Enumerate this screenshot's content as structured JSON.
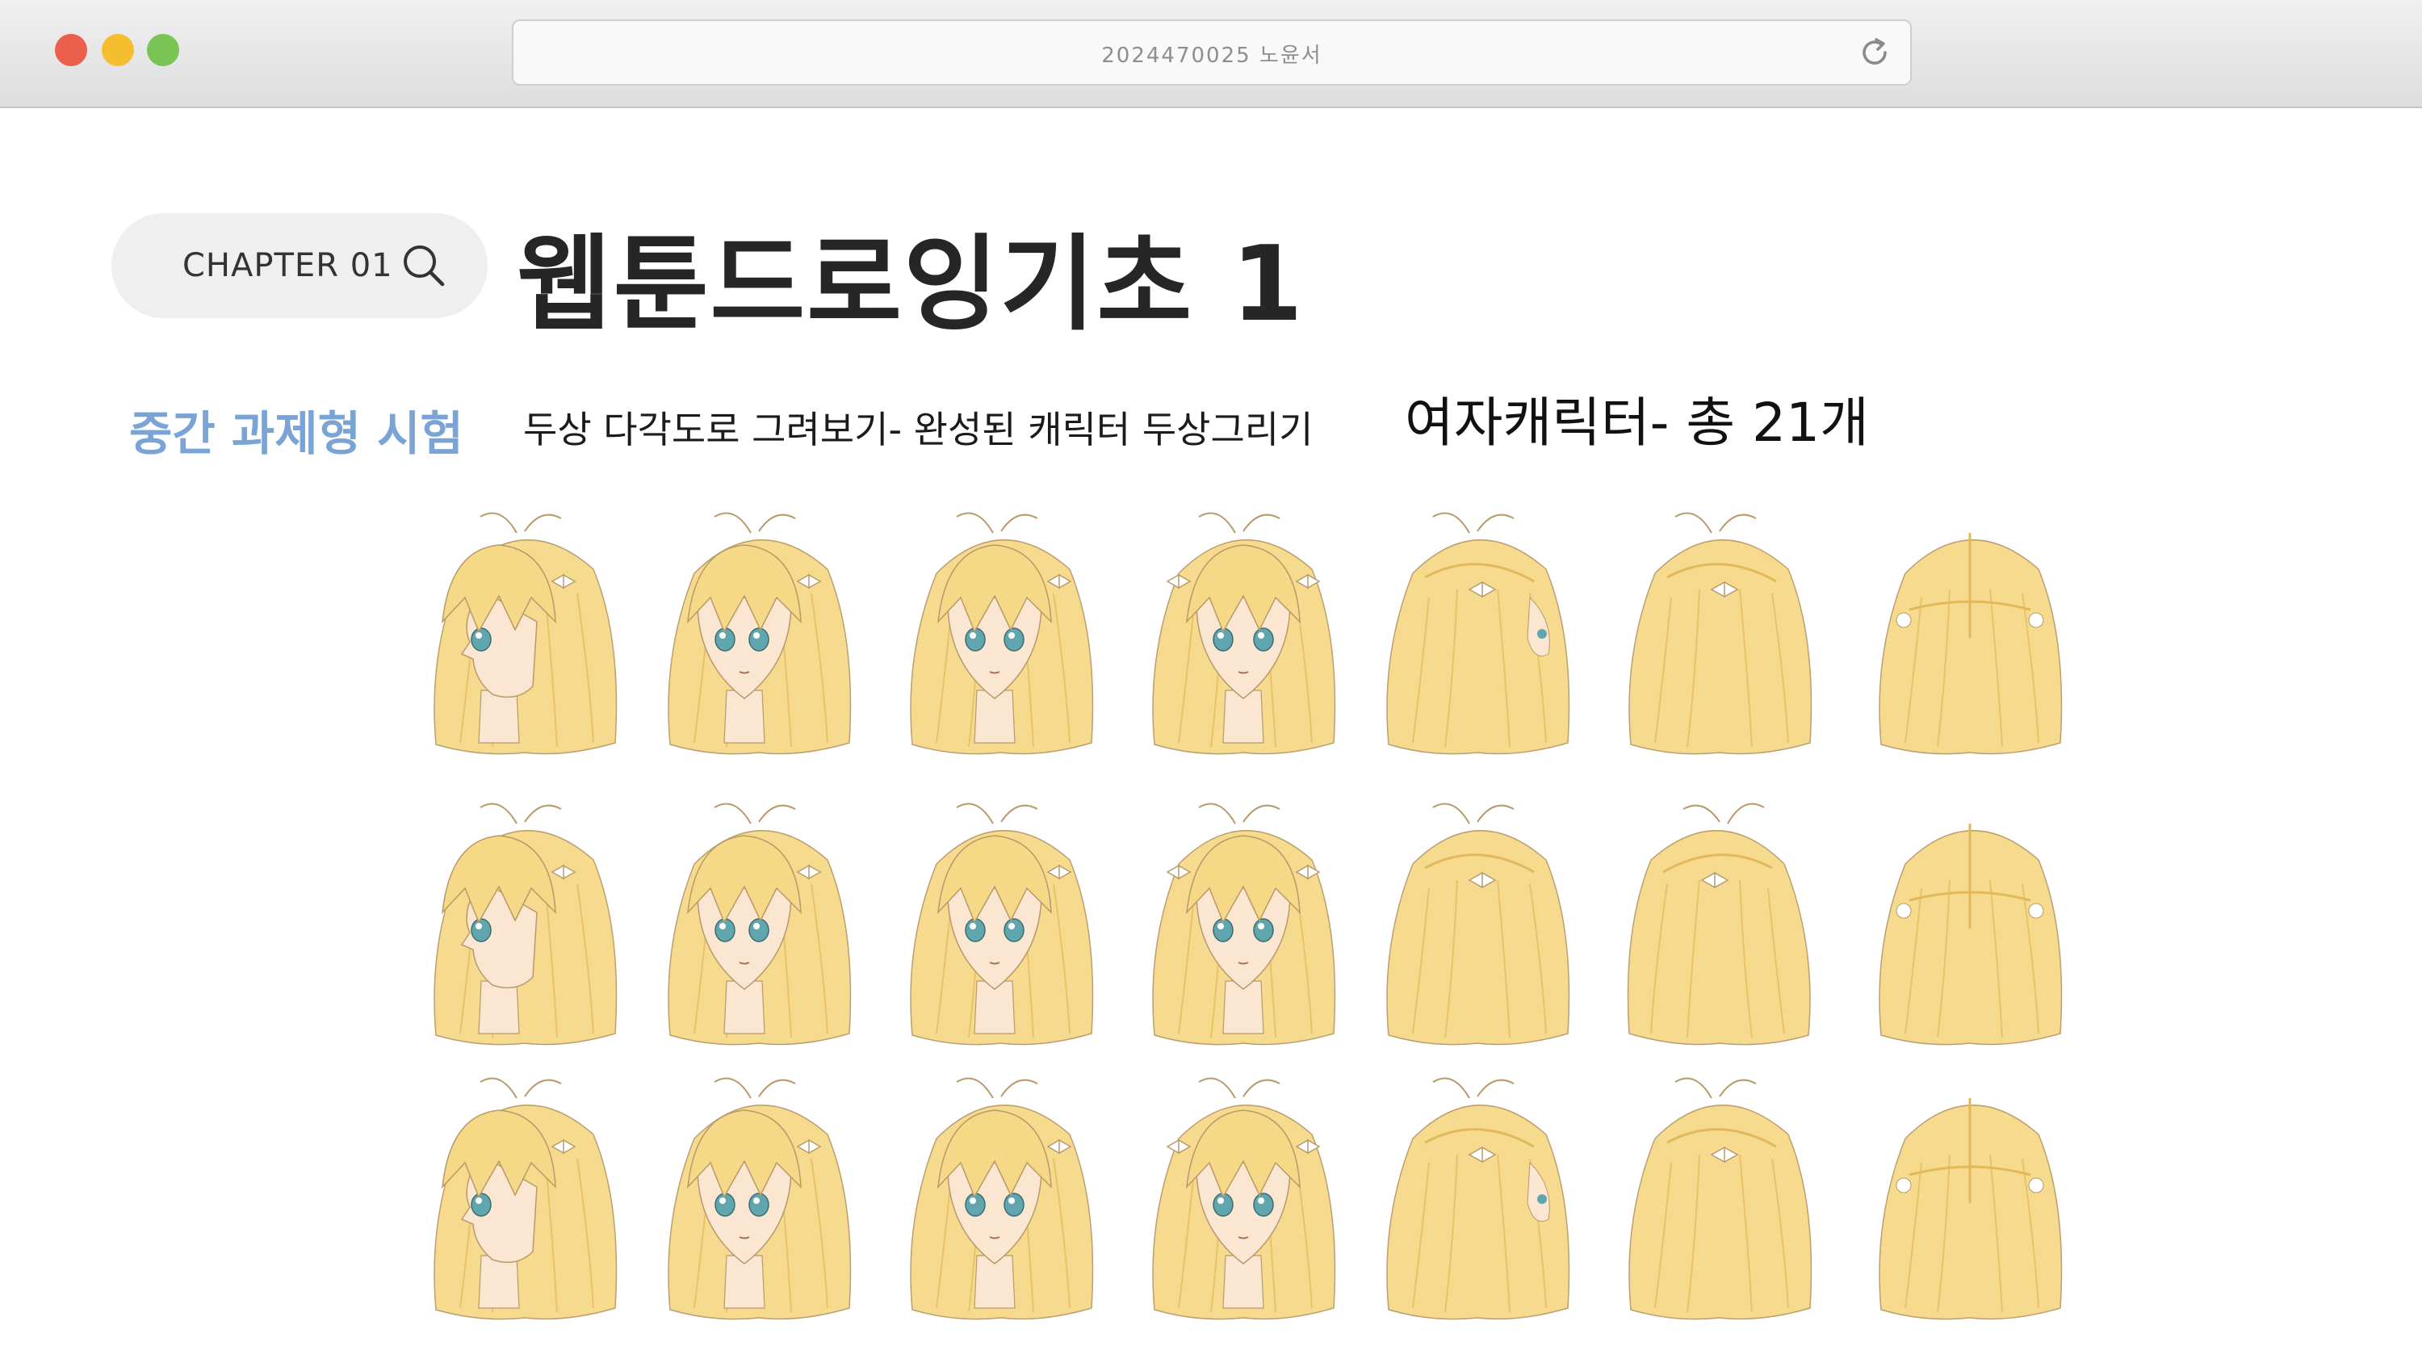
{
  "window": {
    "address": "2024470025 노윤서",
    "controls": [
      "close",
      "minimize",
      "maximize"
    ],
    "reload_icon": "reload-icon"
  },
  "header": {
    "chapter_label": "CHAPTER 01",
    "search_icon": "search-icon",
    "title": "웹툰드로잉기초 1"
  },
  "assignment": {
    "exam_label": "중간 과제형 시험",
    "description": "두상 다각도로 그려보기- 완성된 캐릭터 두상그리기",
    "count_label": "여자캐릭터- 총 21개"
  },
  "colors": {
    "accent_blue": "#7aa3d6",
    "hair": "#f6d987",
    "skin": "#fbe6d2",
    "eyes": "#5fa6ae",
    "bow": "#ffffff"
  },
  "sheet": {
    "rows": [
      {
        "views": [
          "profile-left",
          "three-quarter-left",
          "slight-left",
          "front",
          "three-quarter-back-right",
          "back-right",
          "back"
        ]
      },
      {
        "views": [
          "profile-left",
          "three-quarter-left",
          "slight-left",
          "front",
          "back-right",
          "back-left",
          "back"
        ]
      },
      {
        "views": [
          "profile-left",
          "three-quarter-left",
          "slight-left",
          "front",
          "three-quarter-back-right",
          "back-right",
          "back"
        ]
      }
    ]
  }
}
